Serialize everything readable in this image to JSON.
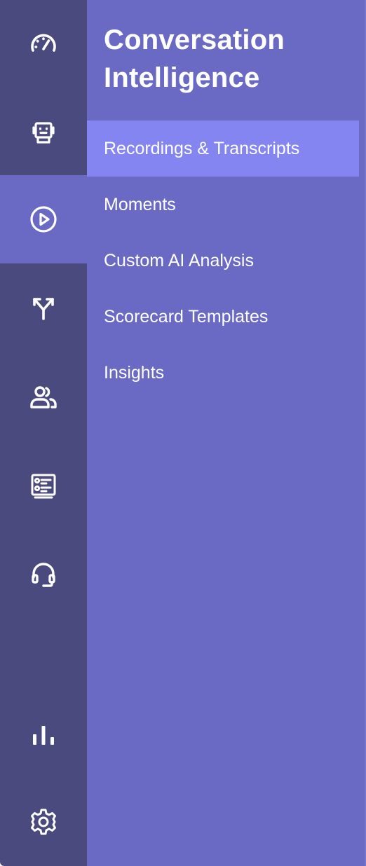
{
  "rail": {
    "items": [
      {
        "id": "dashboard",
        "icon": "speedometer-icon",
        "active": false
      },
      {
        "id": "bots",
        "icon": "robot-icon",
        "active": false
      },
      {
        "id": "conversation-intelligence",
        "icon": "play-circle-icon",
        "active": true
      },
      {
        "id": "routing",
        "icon": "split-arrows-icon",
        "active": false
      },
      {
        "id": "contacts",
        "icon": "people-icon",
        "active": false
      },
      {
        "id": "forms",
        "icon": "list-card-icon",
        "active": false
      },
      {
        "id": "support",
        "icon": "headset-icon",
        "active": false
      },
      {
        "id": "reports",
        "icon": "bar-chart-icon",
        "active": false
      },
      {
        "id": "settings",
        "icon": "gear-icon",
        "active": false
      }
    ],
    "colors": {
      "background": "#4a4a7e",
      "active": "#6a6ac4"
    }
  },
  "panel": {
    "title": "Conversation Intelligence",
    "items": [
      {
        "label": "Recordings & Transcripts",
        "active": true
      },
      {
        "label": "Moments",
        "active": false
      },
      {
        "label": "Custom AI Analysis",
        "active": false
      },
      {
        "label": "Scorecard Templates",
        "active": false
      },
      {
        "label": "Insights",
        "active": false
      }
    ],
    "colors": {
      "background": "#6a6ac4",
      "active_item": "#8585f2",
      "text": "#ffffff"
    }
  }
}
